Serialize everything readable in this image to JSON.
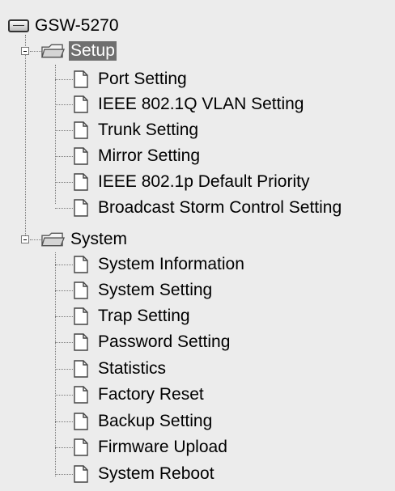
{
  "tree": {
    "root_label": "GSW-5270",
    "groups": [
      {
        "label": "Setup",
        "selected": true,
        "expanded": true,
        "items": [
          "Port Setting",
          "IEEE 802.1Q VLAN Setting",
          "Trunk Setting",
          "Mirror Setting",
          "IEEE 802.1p Default Priority",
          "Broadcast Storm Control Setting"
        ]
      },
      {
        "label": "System",
        "selected": false,
        "expanded": true,
        "items": [
          "System Information",
          "System Setting",
          "Trap Setting",
          "Password Setting",
          "Statistics",
          "Factory Reset",
          "Backup Setting",
          "Firmware Upload",
          "System Reboot"
        ]
      }
    ]
  },
  "colors": {
    "panel_background": "#ececec",
    "selected_background": "#6f6f6f",
    "selected_text": "#ffffff",
    "tree_lines": "#7a7a7a"
  },
  "icons": {
    "root": "drive-icon",
    "group": "folder-icon",
    "item": "document-icon",
    "toggle": "collapse-minus-icon"
  }
}
